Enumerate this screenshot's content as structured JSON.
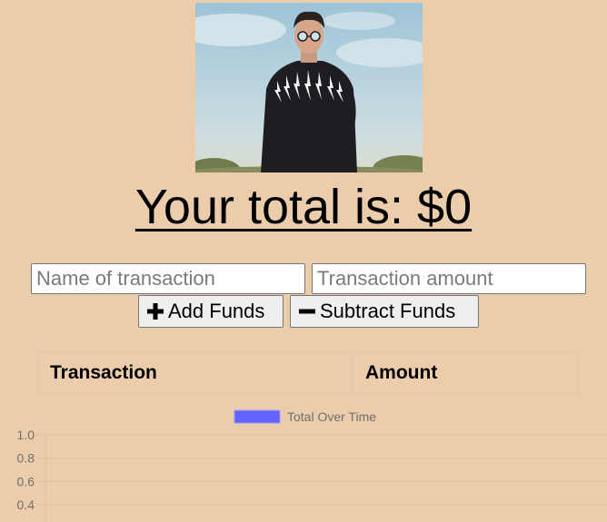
{
  "photo": {
    "label": "profile-photo"
  },
  "total": {
    "prefix": "Your total is: ",
    "amount": "$0"
  },
  "form": {
    "name_placeholder": "Name of transaction",
    "amount_placeholder": "Transaction amount",
    "add_label": "Add Funds",
    "subtract_label": "Subtract Funds"
  },
  "table": {
    "headers": [
      "Transaction",
      "Amount"
    ]
  },
  "colors": {
    "background": "#ebcdab",
    "series": "#6363ff",
    "grid": "#dcc2a0"
  },
  "chart_data": {
    "type": "line",
    "legend": [
      "Total Over Time"
    ],
    "legend_position": "top",
    "ylim": [
      0,
      1.0
    ],
    "yticks": [
      "1.0",
      "0.8",
      "0.6",
      "0.4"
    ],
    "grid": true,
    "series": [
      {
        "name": "Total Over Time",
        "values": []
      }
    ]
  }
}
